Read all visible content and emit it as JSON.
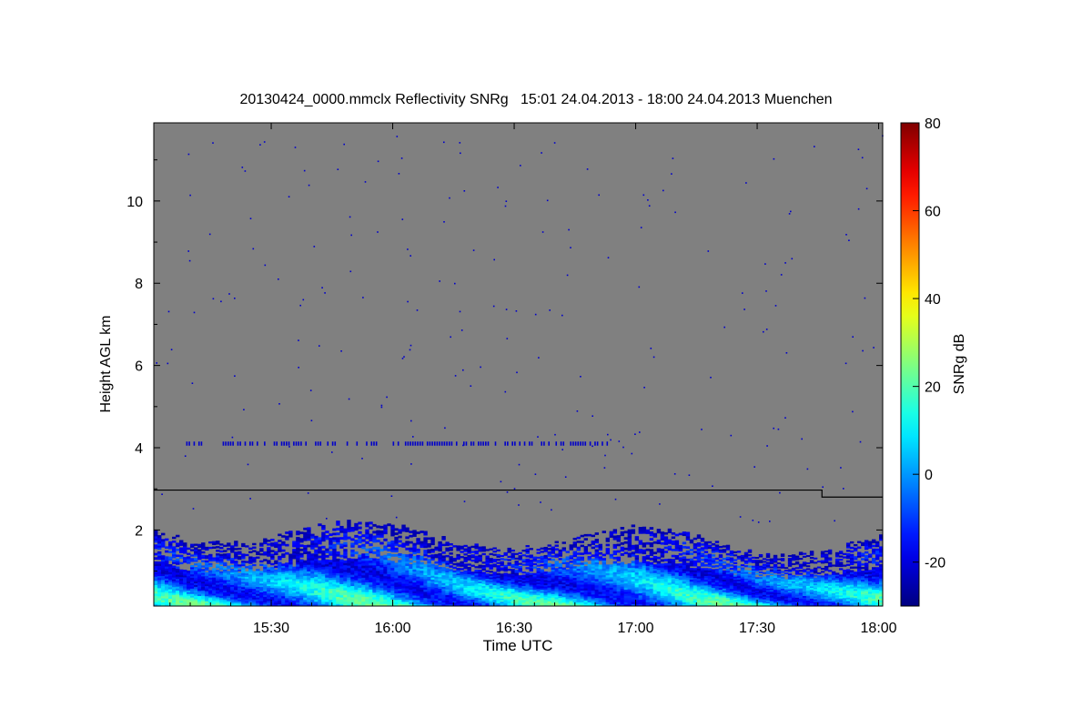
{
  "chart_data": {
    "type": "heatmap",
    "title": "20130424_0000.mmclx Reflectivity SNRg   15:01 24.04.2013 - 18:00 24.04.2013 Muenchen",
    "xlabel": "Time UTC",
    "ylabel": "Height AGL km",
    "x_ticks": [
      "15:30",
      "16:00",
      "16:30",
      "17:00",
      "17:30",
      "18:00"
    ],
    "x_tick_minutes": [
      29,
      59,
      89,
      119,
      149,
      179
    ],
    "xlim_minutes": [
      0,
      180
    ],
    "y_ticks": [
      2,
      4,
      6,
      8,
      10
    ],
    "ylim": [
      0.15,
      11.9
    ],
    "colorbar": {
      "label": "SNRg dB",
      "ticks": [
        -20,
        0,
        20,
        40,
        60,
        80
      ],
      "range": [
        -30,
        80
      ],
      "colormap": "jet"
    },
    "background_color": "#808080",
    "echo_layers": [
      {
        "minutes": [
          0,
          180
        ],
        "height_km": [
          0.15,
          2.0
        ],
        "snr_db": [
          -25,
          25
        ]
      },
      {
        "minutes": [
          8,
          112
        ],
        "height_km": [
          4.05,
          4.15
        ],
        "snr_db": [
          -22,
          -18
        ]
      }
    ],
    "reference_line": {
      "segments": [
        {
          "from_minute": 0,
          "to_minute": 165,
          "height_km": 2.97
        },
        {
          "from_minute": 165,
          "to_minute": 180,
          "height_km": 2.8
        }
      ]
    }
  }
}
